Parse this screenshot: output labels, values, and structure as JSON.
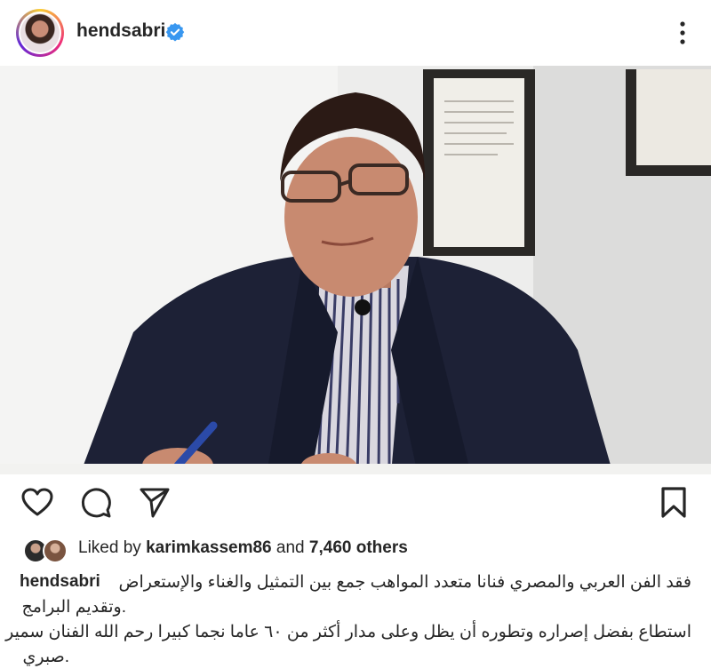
{
  "post": {
    "username": "hendsabri",
    "verified": true,
    "avatar_icon": "profile-avatar",
    "more_icon": "more-vertical-icon",
    "photo_alt": "photo"
  },
  "actions": {
    "like_icon": "heart-icon",
    "comment_icon": "comment-icon",
    "share_icon": "send-icon",
    "save_icon": "bookmark-icon"
  },
  "likes": {
    "prefix": "Liked by",
    "user": "karimkassem86",
    "and": "and",
    "count": "7,460 others"
  },
  "caption": {
    "user": "hendsabri",
    "line1": "فقد الفن العربي والمصري فنانا متعدد المواهب جمع بين التمثيل والغناء والإستعراض",
    "line2": ".وتقديم البرامج",
    "line3": "استطاع بفضل إصراره وتطوره أن يظل وعلى مدار أكثر من ٦٠ عاما نجما كبيرا رحم الله الفنان سمير",
    "line4": ".صبري"
  },
  "colors": {
    "text": "#262626",
    "verified": "#3897f0",
    "suit": "#1d2136"
  }
}
